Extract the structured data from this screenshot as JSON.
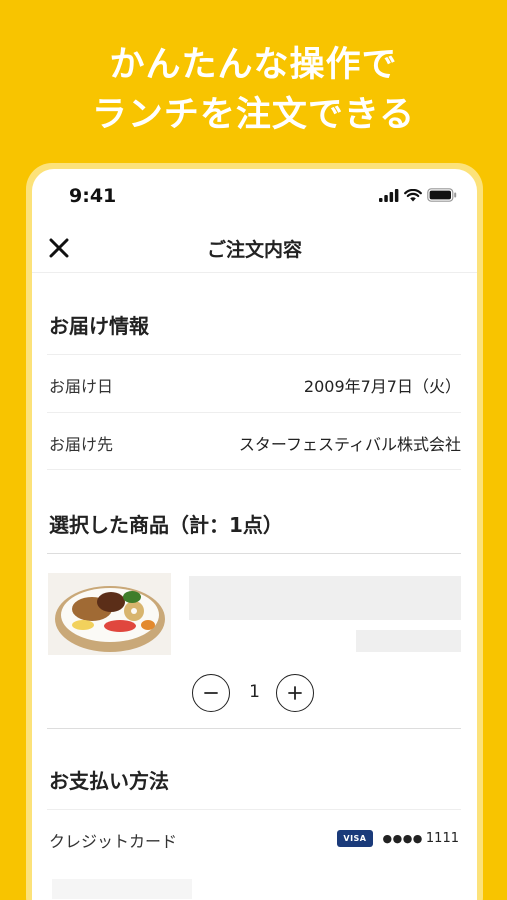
{
  "headline": {
    "line1": "かんたんな操作で",
    "line2": "ランチを注文できる"
  },
  "status_bar": {
    "time": "9:41",
    "icons": [
      "signal-icon",
      "wifi-icon",
      "battery-icon"
    ]
  },
  "navbar": {
    "close_icon": "close-icon",
    "title": "ご注文内容"
  },
  "delivery": {
    "title": "お届け情報",
    "date_label": "お届け日",
    "date_value": "2009年7月7日（火）",
    "dest_label": "お届け先",
    "dest_value": "スターフェスティバル株式会社"
  },
  "products": {
    "title": "選択した商品（計：1点）",
    "quantity": "1",
    "minus_icon": "minus-icon",
    "plus_icon": "plus-icon"
  },
  "payment": {
    "title": "お支払い方法",
    "method_label": "クレジットカード",
    "card_brand": "VISA",
    "card_mask": "●●●●",
    "card_last4": "1111"
  },
  "colors": {
    "background": "#F8C400",
    "frame": "#FCE27A",
    "visa": "#1a3a7a"
  }
}
